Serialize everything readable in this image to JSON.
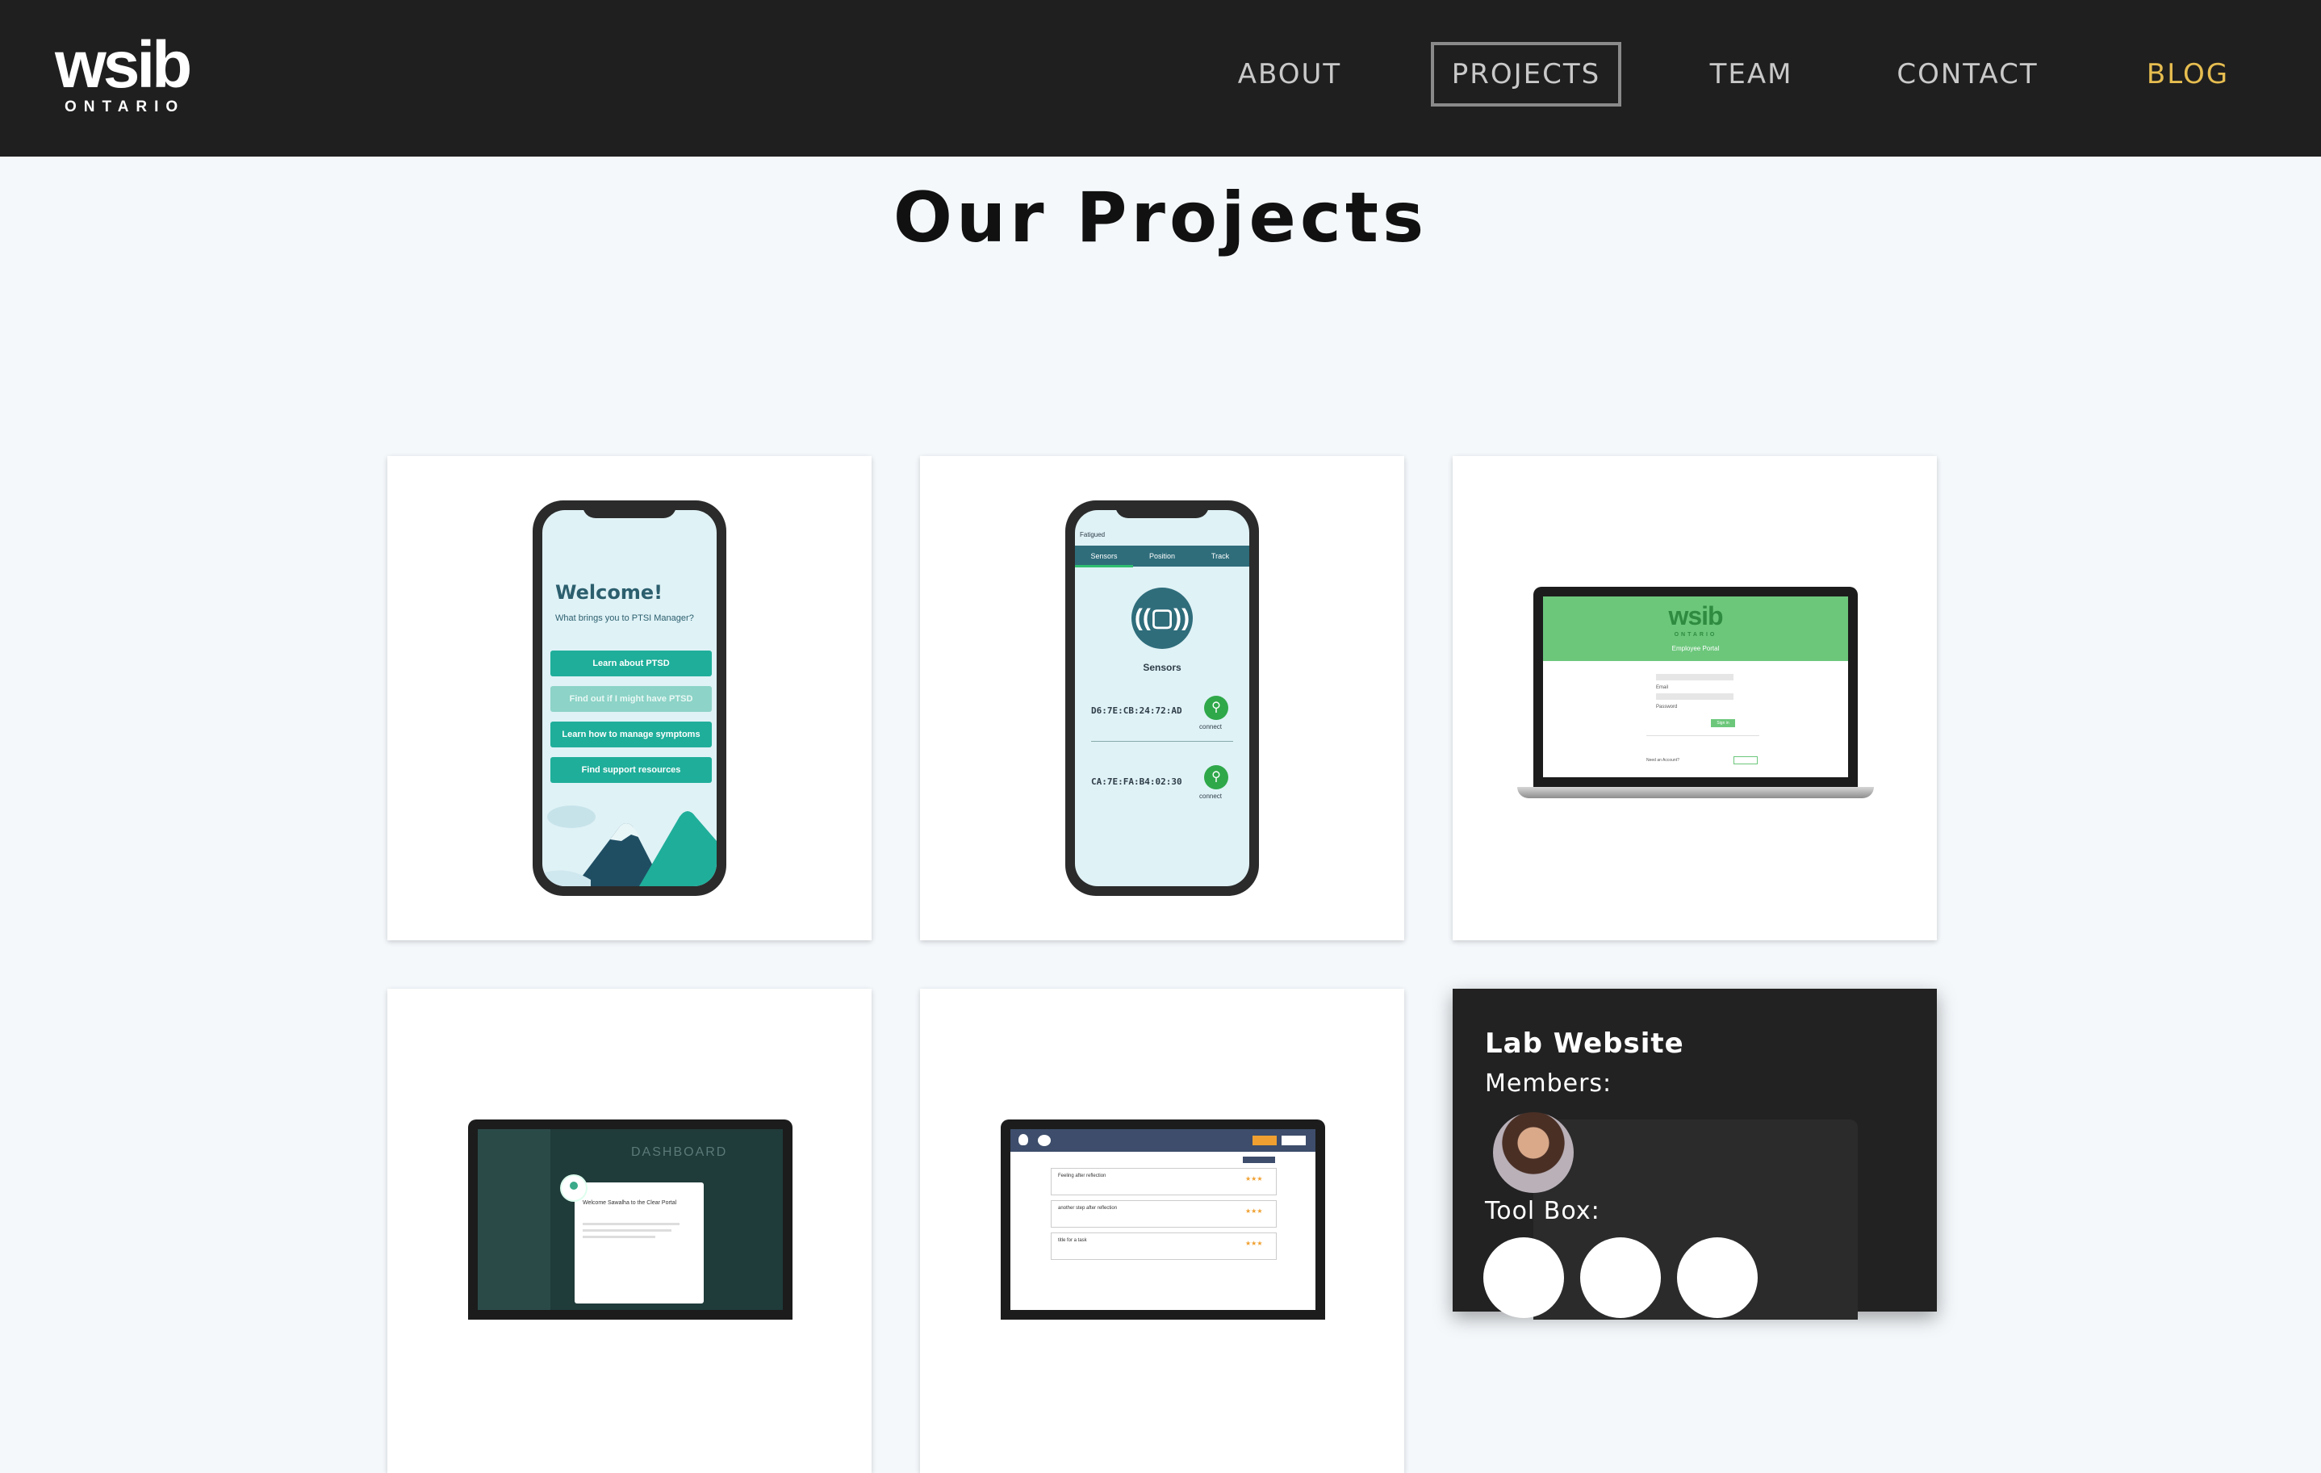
{
  "nav": {
    "logo_main": "wsib",
    "logo_sub": "ONTARIO",
    "items": [
      {
        "label": "ABOUT"
      },
      {
        "label": "PROJECTS"
      },
      {
        "label": "TEAM"
      },
      {
        "label": "CONTACT"
      },
      {
        "label": "BLOG"
      }
    ],
    "active": "PROJECTS",
    "accent_color": "#e6bd50"
  },
  "page": {
    "title": "Our Projects"
  },
  "projects": {
    "ptsd_app": {
      "welcome": "Welcome!",
      "subtitle": "What brings you to PTSI Manager?",
      "buttons": [
        {
          "label": "Learn about PTSD"
        },
        {
          "label": "Find out if I might have PTSD"
        },
        {
          "label": "Learn how to manage symptoms"
        },
        {
          "label": "Find support resources"
        }
      ]
    },
    "sensor_app": {
      "app_name": "Fatigued",
      "tabs": [
        {
          "label": "Sensors"
        },
        {
          "label": "Position"
        },
        {
          "label": "Track"
        }
      ],
      "section": "Sensors",
      "devices": [
        {
          "mac": "D6:7E:CB:24:72:AD",
          "action": "connect"
        },
        {
          "mac": "CA:7E:FA:B4:02:30",
          "action": "connect"
        }
      ]
    },
    "employee_portal": {
      "logo_main": "wsib",
      "logo_sub": "ONTARIO",
      "portal_title": "Employee Portal",
      "email_label": "Email",
      "password_label": "Password",
      "signin_label": "Sign in",
      "need_account": "Need an Account?"
    },
    "dashboard": {
      "title": "DASHBOARD",
      "welcome_text": "Welcome Sawalha to the Clear Portal"
    },
    "task_list": {
      "rows": [
        "Feeling after reflection",
        "another step after reflection",
        "title for a task"
      ]
    },
    "lab_website": {
      "title": "Lab Website",
      "members_label": "Members:",
      "toolbox_label": "Tool Box:"
    }
  }
}
